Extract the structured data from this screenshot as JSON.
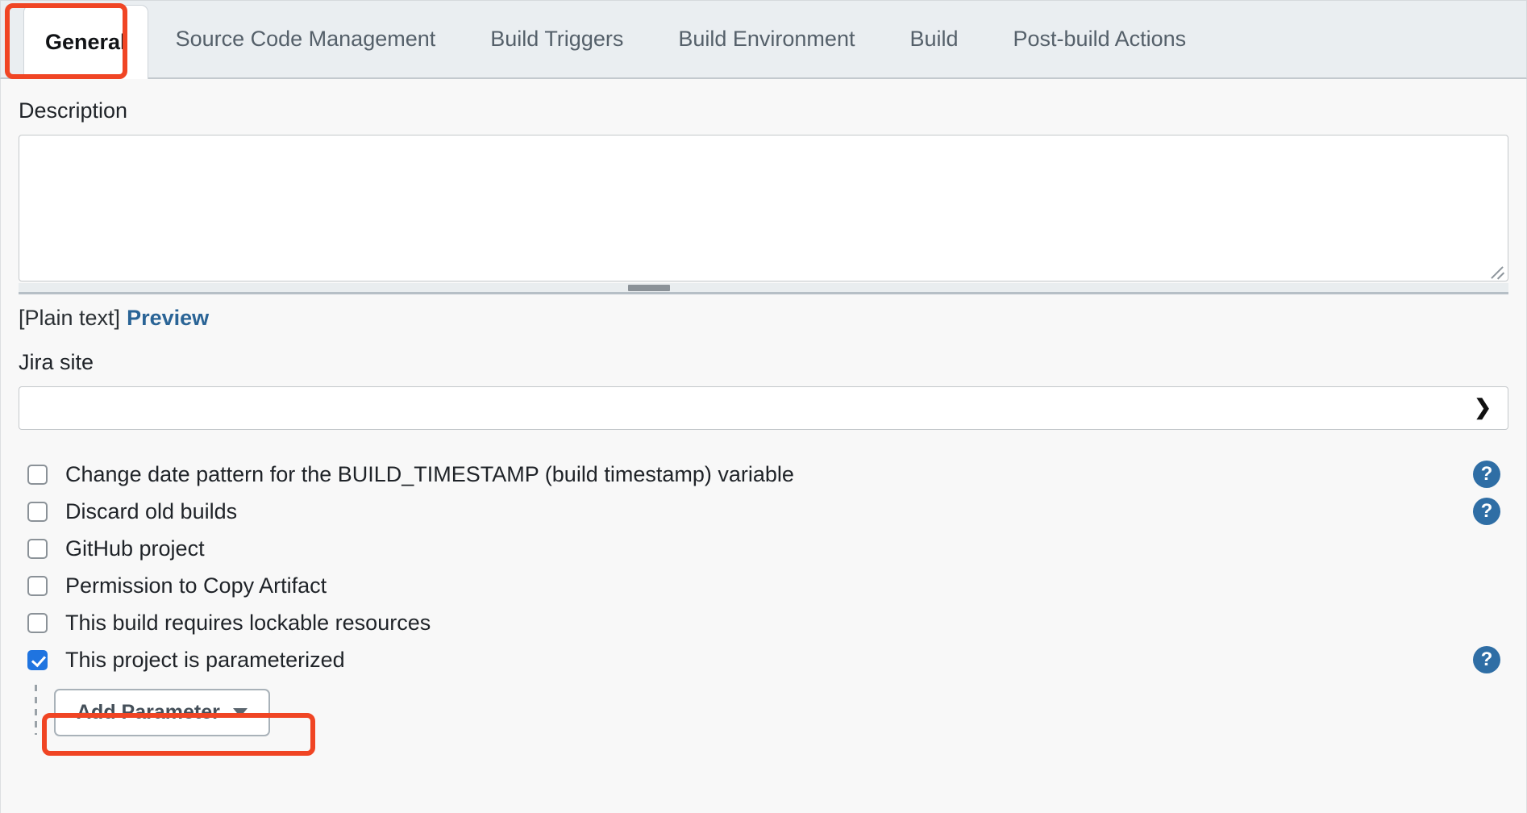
{
  "tabs": [
    {
      "label": "General",
      "active": true
    },
    {
      "label": "Source Code Management",
      "active": false
    },
    {
      "label": "Build Triggers",
      "active": false
    },
    {
      "label": "Build Environment",
      "active": false
    },
    {
      "label": "Build",
      "active": false
    },
    {
      "label": "Post-build Actions",
      "active": false
    }
  ],
  "description": {
    "label": "Description",
    "value": "",
    "markup_note": "[Plain text]",
    "preview_link": "Preview"
  },
  "jira": {
    "label": "Jira site",
    "selected_value": "",
    "caret_icon": "chevron-down-icon"
  },
  "checkboxes": [
    {
      "label": "Change date pattern for the BUILD_TIMESTAMP (build timestamp) variable",
      "checked": false,
      "help": true
    },
    {
      "label": "Discard old builds",
      "checked": false,
      "help": true
    },
    {
      "label": "GitHub project",
      "checked": false,
      "help": false
    },
    {
      "label": "Permission to Copy Artifact",
      "checked": false,
      "help": false
    },
    {
      "label": "This build requires lockable resources",
      "checked": false,
      "help": false
    },
    {
      "label": "This project is parameterized",
      "checked": true,
      "help": true
    }
  ],
  "add_parameter": {
    "label": "Add Parameter",
    "caret_icon": "caret-down-icon"
  },
  "help_icon_glyph": "?",
  "colors": {
    "annotation": "#f04524",
    "checkbox_checked": "#1f74e0",
    "help_icon": "#2f6ea5",
    "link": "#2a6496",
    "tabbar_bg": "#eaeef1",
    "page_bg": "#f8f8f8"
  },
  "annotations": [
    {
      "name": "general-tab-highlight",
      "target": "General"
    },
    {
      "name": "parameterized-label-highlight",
      "target": "This project is parameterized"
    }
  ]
}
